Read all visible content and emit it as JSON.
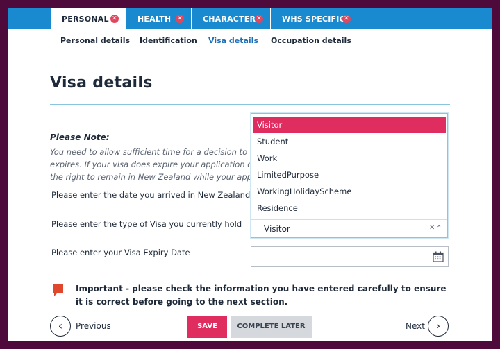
{
  "tabs": [
    {
      "label": "PERSONAL",
      "active": true
    },
    {
      "label": "HEALTH",
      "active": false
    },
    {
      "label": "CHARACTER",
      "active": false
    },
    {
      "label": "WHS SPECIFIC",
      "active": false
    }
  ],
  "subnav": {
    "personal_details": "Personal details",
    "identification": "Identification",
    "visa_details": "Visa details",
    "occupation_details": "Occupation details"
  },
  "page_title": "Visa details",
  "note": {
    "title": "Please Note:",
    "lines": [
      "You need to allow sufficient time for a decision to be m",
      "expires. If your visa does expire your application does",
      "the right to remain in New Zealand while your applicat"
    ]
  },
  "fields": {
    "arrival_label": "Please enter the date you arrived in New Zealand",
    "visa_type_label": "Please enter the type of Visa you currently hold",
    "expiry_label": "Please enter your Visa Expiry Date"
  },
  "visa_dropdown": {
    "options": [
      "Visitor",
      "Student",
      "Work",
      "LimitedPurpose",
      "WorkingHolidayScheme",
      "Residence"
    ],
    "selected": "Visitor"
  },
  "important": {
    "text": "Important - please check the information you have entered carefully to ensure it is correct before going to the next section."
  },
  "buttons": {
    "previous": "Previous",
    "save": "SAVE",
    "complete_later": "COMPLETE LATER",
    "next": "Next"
  },
  "colors": {
    "accent": "#e02d60",
    "tab_bar": "#1a8ad0",
    "frame": "#4d0a3b"
  }
}
